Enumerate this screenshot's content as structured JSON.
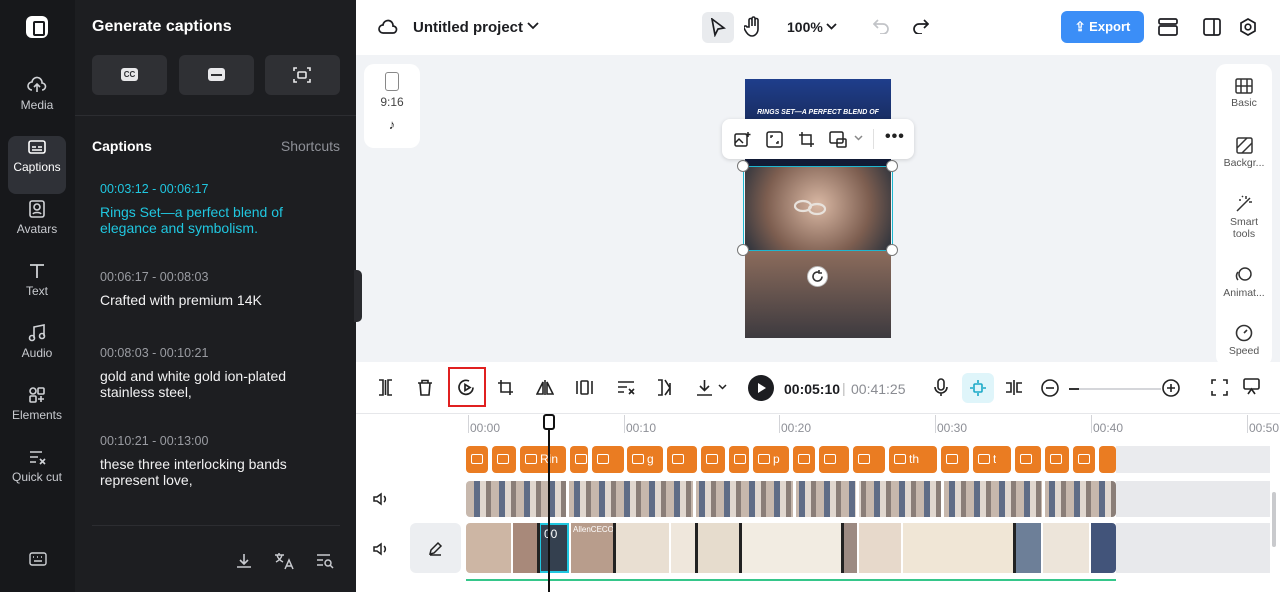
{
  "rail": {
    "items": [
      {
        "label": "Media",
        "icon": "cloud-upload-icon"
      },
      {
        "label": "Captions",
        "icon": "captions-icon",
        "active": true
      },
      {
        "label": "Avatars",
        "icon": "avatar-icon"
      },
      {
        "label": "Text",
        "icon": "text-icon"
      },
      {
        "label": "Audio",
        "icon": "music-note-icon"
      },
      {
        "label": "Elements",
        "icon": "elements-icon"
      },
      {
        "label": "Quick cut",
        "icon": "quick-cut-icon"
      }
    ]
  },
  "panel": {
    "title": "Generate captions",
    "section_title": "Captions",
    "shortcuts_label": "Shortcuts",
    "captions": [
      {
        "time": "00:03:12 - 00:06:17",
        "text": "Rings Set—a perfect blend of elegance and symbolism.",
        "active": true
      },
      {
        "time": "00:06:17 - 00:08:03",
        "text": "Crafted with premium 14K"
      },
      {
        "time": "00:08:03 - 00:10:21",
        "text": "gold and white gold ion-plated stainless steel,"
      },
      {
        "time": "00:10:21 - 00:13:00",
        "text": "these three interlocking bands represent love,"
      }
    ]
  },
  "topbar": {
    "project_name": "Untitled project",
    "zoom": "100%",
    "export_label": "Export"
  },
  "ratio": {
    "label": "9:16"
  },
  "canvas": {
    "caption_overlay": "RINGS SET—A PERFECT BLEND OF"
  },
  "right_panel": {
    "items": [
      "Basic",
      "Backgr...",
      "Smart tools",
      "Animat...",
      "Speed"
    ]
  },
  "playback": {
    "current": "00:05:10",
    "separator": "|",
    "total": "00:41:25"
  },
  "timeline": {
    "ruler": [
      "00:00",
      "00:10",
      "00:20",
      "00:30",
      "00:40",
      "00:50"
    ],
    "caption_clip_texts": [
      "Rin",
      "g",
      "p",
      "th",
      "t"
    ],
    "media_clip_text": "AllenCECO",
    "selected_clip_text": "00"
  },
  "colors": {
    "accent": "#20c7e0",
    "caption_clip": "#ea7c22",
    "export": "#3b8ef7",
    "highlight_box": "#e02020"
  }
}
